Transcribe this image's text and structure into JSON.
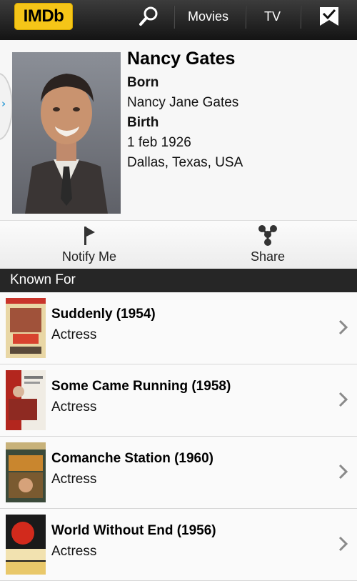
{
  "topbar": {
    "logo": "IMDb",
    "search_icon": "search-icon",
    "nav_movies": "Movies",
    "nav_tv": "TV",
    "checklist_icon": "checklist-icon"
  },
  "person": {
    "name": "Nancy Gates",
    "born_label": "Born",
    "born_name": "Nancy Jane Gates",
    "birth_label": "Birth",
    "birth_date": "1 feb 1926",
    "birth_place": "Dallas, Texas, USA"
  },
  "actions": {
    "notify_label": "Notify Me",
    "share_label": "Share"
  },
  "known_for": {
    "heading": "Known For",
    "items": [
      {
        "title": "Suddenly (1954)",
        "role": "Actress"
      },
      {
        "title": "Some Came Running (1958)",
        "role": "Actress"
      },
      {
        "title": "Comanche Station (1960)",
        "role": "Actress"
      },
      {
        "title": "World Without End (1956)",
        "role": "Actress"
      }
    ]
  },
  "colors": {
    "imdb_yellow": "#f5c518",
    "topbar_dark": "#1e1e1e",
    "accent_blue": "#3aa0d8"
  }
}
